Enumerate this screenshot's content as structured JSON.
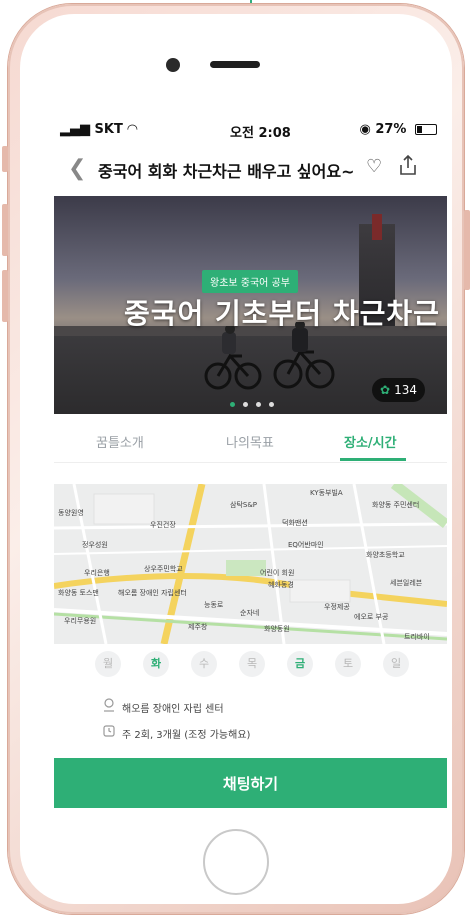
{
  "status": {
    "carrier": "SKT",
    "time": "오전 2:08",
    "battery": "27%"
  },
  "nav": {
    "title": "중국어 회화 차근차근 배우고 싶어요~"
  },
  "hero": {
    "tag": "왕초보 중국어 공부",
    "title": "중국어 기초부터 차근차근",
    "likes": "134"
  },
  "tabs": [
    {
      "label": "꿈틀소개"
    },
    {
      "label": "나의목표"
    },
    {
      "label": "장소/시간"
    }
  ],
  "map": {
    "labels": [
      "KY동부빌A",
      "삼탁S&P",
      "화양동 주민센터",
      "우진건장",
      "덕화맨션",
      "정우성원",
      "EQ어반마인",
      "화양초등학교",
      "우리은행",
      "상우주민학교",
      "세븐일레븐",
      "해오롬 장애인 자립센터",
      "능동로",
      "어린이 회원",
      "혜화동경",
      "우정제공",
      "순자네",
      "제주창",
      "화양동원",
      "화양동 토스맨",
      "동양원영",
      "우리무용원",
      "에오로 부공",
      "트리바이"
    ]
  },
  "days": [
    "월",
    "화",
    "수",
    "목",
    "금",
    "토",
    "일"
  ],
  "info": {
    "place": "해오름 장애인 자립 센터",
    "schedule": "주 2회, 3개월 (조정 가능해요)"
  },
  "cta": {
    "label": "채팅하기"
  },
  "colors": {
    "accent": "#2eaf76"
  }
}
